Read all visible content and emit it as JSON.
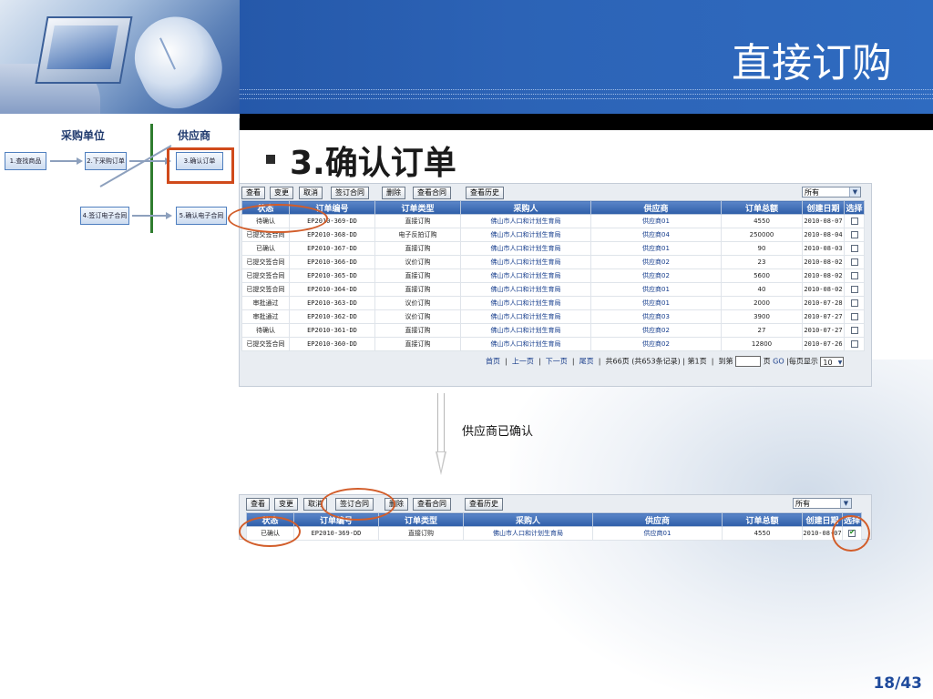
{
  "slide": {
    "title": "直接订购",
    "step_title": "3.确认订单",
    "confirm_note": "供应商已确认",
    "page_number": "18/43"
  },
  "flow": {
    "lane_buyer": "采购单位",
    "lane_supplier": "供应商",
    "steps": [
      "1.查找商品",
      "2.下采购订单",
      "3.确认订单",
      "4.签订电子合同",
      "5.确认电子合同"
    ]
  },
  "toolbar": {
    "buttons": [
      "查看",
      "变更",
      "取消",
      "签订合同",
      "删除",
      "查看合同",
      "查看历史"
    ],
    "filter_value": "所有"
  },
  "table": {
    "columns": [
      "状态",
      "订单编号",
      "订单类型",
      "采购人",
      "供应商",
      "订单总额",
      "创建日期",
      "选择"
    ],
    "rows": [
      [
        "待确认",
        "EP2010-369-DD",
        "直接订购",
        "佛山市人口和计划生育局",
        "供应商01",
        "4550",
        "2010-08-07"
      ],
      [
        "已提交签合同",
        "EP2010-368-DD",
        "电子反拍订购",
        "佛山市人口和计划生育局",
        "供应商04",
        "250000",
        "2010-08-04"
      ],
      [
        "已确认",
        "EP2010-367-DD",
        "直接订购",
        "佛山市人口和计划生育局",
        "供应商01",
        "90",
        "2010-08-03"
      ],
      [
        "已提交签合同",
        "EP2010-366-DD",
        "议价订购",
        "佛山市人口和计划生育局",
        "供应商02",
        "23",
        "2010-08-02"
      ],
      [
        "已提交签合同",
        "EP2010-365-DD",
        "直接订购",
        "佛山市人口和计划生育局",
        "供应商02",
        "5600",
        "2010-08-02"
      ],
      [
        "已提交签合同",
        "EP2010-364-DD",
        "直接订购",
        "佛山市人口和计划生育局",
        "供应商01",
        "40",
        "2010-08-02"
      ],
      [
        "审批通过",
        "EP2010-363-DD",
        "议价订购",
        "佛山市人口和计划生育局",
        "供应商01",
        "2000",
        "2010-07-28"
      ],
      [
        "审批通过",
        "EP2010-362-DD",
        "议价订购",
        "佛山市人口和计划生育局",
        "供应商03",
        "3900",
        "2010-07-27"
      ],
      [
        "待确认",
        "EP2010-361-DD",
        "直接订购",
        "佛山市人口和计划生育局",
        "供应商02",
        "27",
        "2010-07-27"
      ],
      [
        "已提交签合同",
        "EP2010-360-DD",
        "直接订购",
        "佛山市人口和计划生育局",
        "供应商02",
        "12800",
        "2010-07-26"
      ]
    ]
  },
  "pager": {
    "first": "首页",
    "prev": "上一页",
    "next": "下一页",
    "last": "尾页",
    "summary": "共66页 (共653条记录) | 第1页",
    "goto_label": "到第",
    "page_unit": "页",
    "go": "GO",
    "per_page_label": "|每页显示",
    "per_page_value": "10"
  },
  "result": {
    "row": [
      "已确认",
      "EP2010-369-DD",
      "直接订购",
      "佛山市人口和计划生育局",
      "供应商01",
      "4550",
      "2010-08-07"
    ],
    "checked": true
  },
  "colors": {
    "header_blue": "#2c63b6",
    "grid_header": "#2e5ea8",
    "highlight": "#d25d2a"
  }
}
